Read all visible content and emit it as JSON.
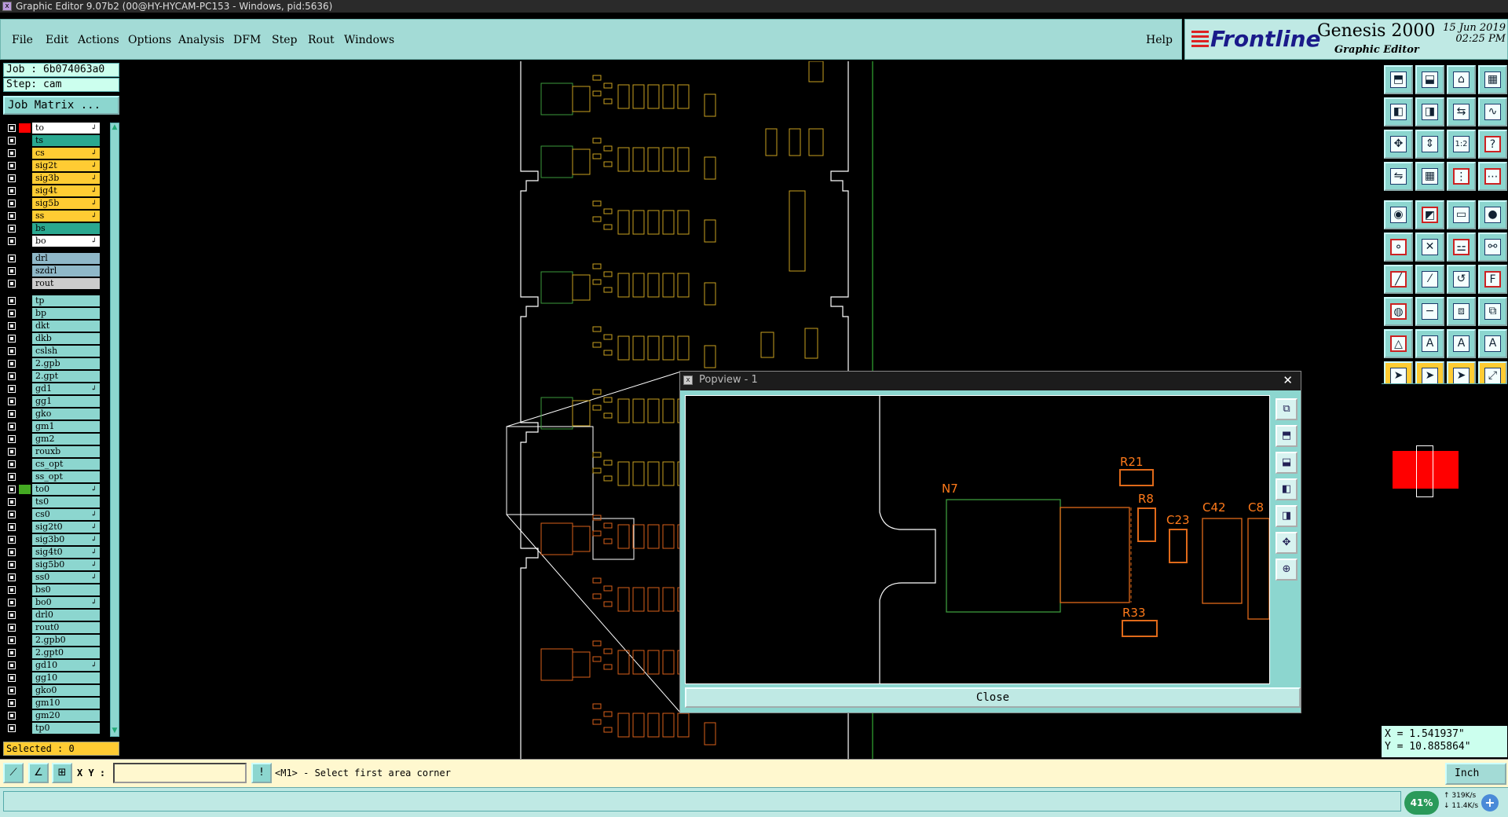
{
  "window": {
    "title": "Graphic Editor 9.07b2 (00@HY-HYCAM-PC153 - Windows, pid:5636)"
  },
  "menu": {
    "items": [
      "File",
      "Edit",
      "Actions",
      "Options",
      "Analysis",
      "DFM",
      "Step",
      "Rout",
      "Windows"
    ],
    "help": "Help"
  },
  "brand": {
    "logo": "Frontline",
    "product": "Genesis 2000",
    "subtitle": "Graphic Editor",
    "date": "15 Jun 2019",
    "time": "02:25 PM"
  },
  "job": {
    "job_label": "Job : 6b074063a0",
    "step_label": "Step: cam",
    "matrix_button": "Job Matrix ..."
  },
  "layers": [
    {
      "name": "to",
      "bg": "#ffffff",
      "color": "#ff0000",
      "mark": "↲"
    },
    {
      "name": "ts",
      "bg": "#2aa890",
      "color": "",
      "mark": ""
    },
    {
      "name": "cs",
      "bg": "#ffcc33",
      "color": "",
      "mark": "↲"
    },
    {
      "name": "sig2t",
      "bg": "#ffcc33",
      "color": "",
      "mark": "↲"
    },
    {
      "name": "sig3b",
      "bg": "#ffcc33",
      "color": "",
      "mark": "↲"
    },
    {
      "name": "sig4t",
      "bg": "#ffcc33",
      "color": "",
      "mark": "↲"
    },
    {
      "name": "sig5b",
      "bg": "#ffcc33",
      "color": "",
      "mark": "↲"
    },
    {
      "name": "ss",
      "bg": "#ffcc33",
      "color": "",
      "mark": "↲"
    },
    {
      "name": "bs",
      "bg": "#2aa890",
      "color": "",
      "mark": ""
    },
    {
      "name": "bo",
      "bg": "#ffffff",
      "color": "",
      "mark": "↲"
    },
    {
      "name": "drl",
      "bg": "#8fb8c8",
      "color": "",
      "mark": ""
    },
    {
      "name": "szdrl",
      "bg": "#8fb8c8",
      "color": "",
      "mark": ""
    },
    {
      "name": "rout",
      "bg": "#cccccc",
      "color": "",
      "mark": ""
    },
    {
      "name": "tp",
      "bg": "#8cd6cf",
      "color": "",
      "mark": ""
    },
    {
      "name": "bp",
      "bg": "#8cd6cf",
      "color": "",
      "mark": ""
    },
    {
      "name": "dkt",
      "bg": "#8cd6cf",
      "color": "",
      "mark": ""
    },
    {
      "name": "dkb",
      "bg": "#8cd6cf",
      "color": "",
      "mark": ""
    },
    {
      "name": "cslsh",
      "bg": "#8cd6cf",
      "color": "",
      "mark": ""
    },
    {
      "name": "2.gpb",
      "bg": "#8cd6cf",
      "color": "",
      "mark": ""
    },
    {
      "name": "2.gpt",
      "bg": "#8cd6cf",
      "color": "",
      "mark": ""
    },
    {
      "name": "gd1",
      "bg": "#8cd6cf",
      "color": "",
      "mark": "↲"
    },
    {
      "name": "gg1",
      "bg": "#8cd6cf",
      "color": "",
      "mark": ""
    },
    {
      "name": "gko",
      "bg": "#8cd6cf",
      "color": "",
      "mark": ""
    },
    {
      "name": "gm1",
      "bg": "#8cd6cf",
      "color": "",
      "mark": ""
    },
    {
      "name": "gm2",
      "bg": "#8cd6cf",
      "color": "",
      "mark": ""
    },
    {
      "name": "rouxb",
      "bg": "#8cd6cf",
      "color": "",
      "mark": ""
    },
    {
      "name": "cs_opt",
      "bg": "#8cd6cf",
      "color": "",
      "mark": ""
    },
    {
      "name": "ss_opt",
      "bg": "#8cd6cf",
      "color": "",
      "mark": ""
    },
    {
      "name": "to0",
      "bg": "#8cd6cf",
      "color": "#44aa22",
      "mark": "↲"
    },
    {
      "name": "ts0",
      "bg": "#8cd6cf",
      "color": "",
      "mark": ""
    },
    {
      "name": "cs0",
      "bg": "#8cd6cf",
      "color": "",
      "mark": "↲"
    },
    {
      "name": "sig2t0",
      "bg": "#8cd6cf",
      "color": "",
      "mark": "↲"
    },
    {
      "name": "sig3b0",
      "bg": "#8cd6cf",
      "color": "",
      "mark": "↲"
    },
    {
      "name": "sig4t0",
      "bg": "#8cd6cf",
      "color": "",
      "mark": "↲"
    },
    {
      "name": "sig5b0",
      "bg": "#8cd6cf",
      "color": "",
      "mark": "↲"
    },
    {
      "name": "ss0",
      "bg": "#8cd6cf",
      "color": "",
      "mark": "↲"
    },
    {
      "name": "bs0",
      "bg": "#8cd6cf",
      "color": "",
      "mark": ""
    },
    {
      "name": "bo0",
      "bg": "#8cd6cf",
      "color": "",
      "mark": "↲"
    },
    {
      "name": "drl0",
      "bg": "#8cd6cf",
      "color": "",
      "mark": ""
    },
    {
      "name": "rout0",
      "bg": "#8cd6cf",
      "color": "",
      "mark": ""
    },
    {
      "name": "2.gpb0",
      "bg": "#8cd6cf",
      "color": "",
      "mark": ""
    },
    {
      "name": "2.gpt0",
      "bg": "#8cd6cf",
      "color": "",
      "mark": ""
    },
    {
      "name": "gd10",
      "bg": "#8cd6cf",
      "color": "",
      "mark": "↲"
    },
    {
      "name": "gg10",
      "bg": "#8cd6cf",
      "color": "",
      "mark": ""
    },
    {
      "name": "gko0",
      "bg": "#8cd6cf",
      "color": "",
      "mark": ""
    },
    {
      "name": "gm10",
      "bg": "#8cd6cf",
      "color": "",
      "mark": ""
    },
    {
      "name": "gm20",
      "bg": "#8cd6cf",
      "color": "",
      "mark": ""
    },
    {
      "name": "tp0",
      "bg": "#8cd6cf",
      "color": "",
      "mark": ""
    }
  ],
  "selected": "Selected : 0",
  "popview": {
    "title": "Popview - 1",
    "close_label": "Close",
    "components": [
      "R21",
      "N7",
      "R8",
      "C23",
      "C42",
      "C8",
      "R33"
    ]
  },
  "coords": {
    "x": "X = 1.541937\"",
    "y": "Y = 10.885864\""
  },
  "command": {
    "xy_label": "X Y :",
    "xy_value": "",
    "prompt": "<M1> - Select first area corner",
    "units": "Inch"
  },
  "network": {
    "percent": "41%",
    "up": "319K/s",
    "down": "11.4K/s",
    "button": "+"
  },
  "toolbox": {
    "rows": [
      [
        "up-icon",
        "down-icon",
        "home-icon",
        "layout-icon"
      ],
      [
        "left-icon",
        "right-icon",
        "swap-icon",
        "snake-icon"
      ],
      [
        "fit-icon",
        "zoom-fit-icon",
        "scale-icon",
        "help-icon"
      ],
      [
        "flip-icon",
        "grid-icon",
        "tree-icon",
        "cascade-icon"
      ],
      [
        "camera-icon",
        "measure-icon",
        "ruler-icon",
        "circle-icon"
      ],
      [
        "net-icon",
        "cross-icon",
        "connect-icon",
        "link-icon"
      ],
      [
        "line-icon",
        "diag-icon",
        "arc-icon",
        "font-icon"
      ],
      [
        "pad-icon",
        "minus-icon",
        "node-icon",
        "route-icon"
      ],
      [
        "triangle-icon",
        "letter-a-icon",
        "letter-a2-icon",
        "letter-a3-icon"
      ],
      [
        "pointer-icon",
        "select-icon",
        "pick-icon",
        "move-icon"
      ]
    ]
  }
}
